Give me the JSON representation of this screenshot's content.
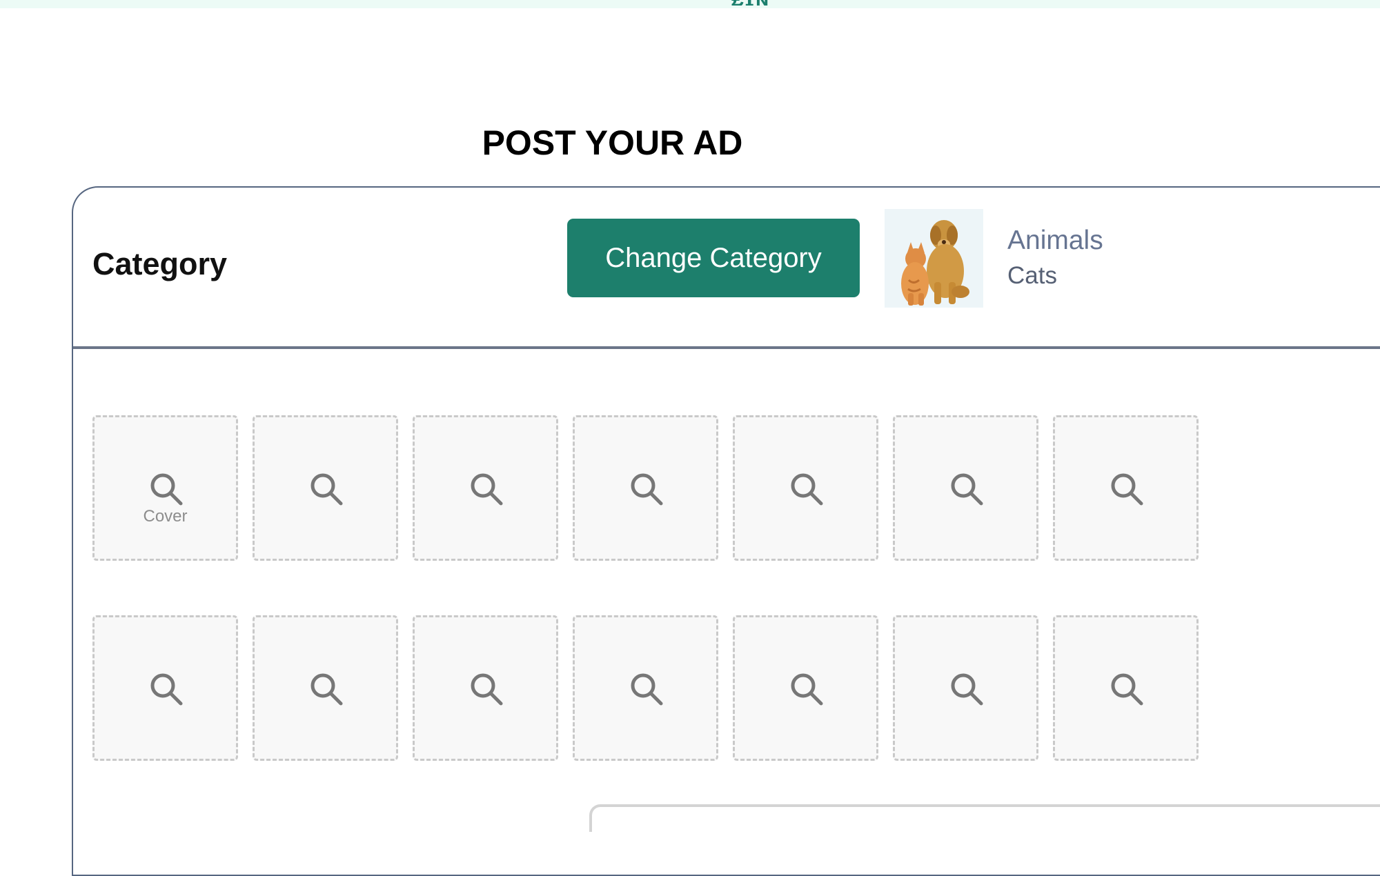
{
  "header": {
    "logo_fragment": "₤ɪɴ"
  },
  "page": {
    "title": "POST YOUR AD"
  },
  "category": {
    "label": "Category",
    "change_button": "Change Category",
    "selected_main": "Animals",
    "selected_sub": "Cats",
    "thumbnail_alt": "dog and cat thumbnail"
  },
  "photos": {
    "cover_label": "Cover",
    "slot_icon": "search-icon",
    "slot_count": 14
  },
  "colors": {
    "accent": "#1d7f6c",
    "card_border": "#566680",
    "muted_text": "#667491",
    "slot_border": "#c9c9c9",
    "slot_bg": "#f8f8f8"
  }
}
